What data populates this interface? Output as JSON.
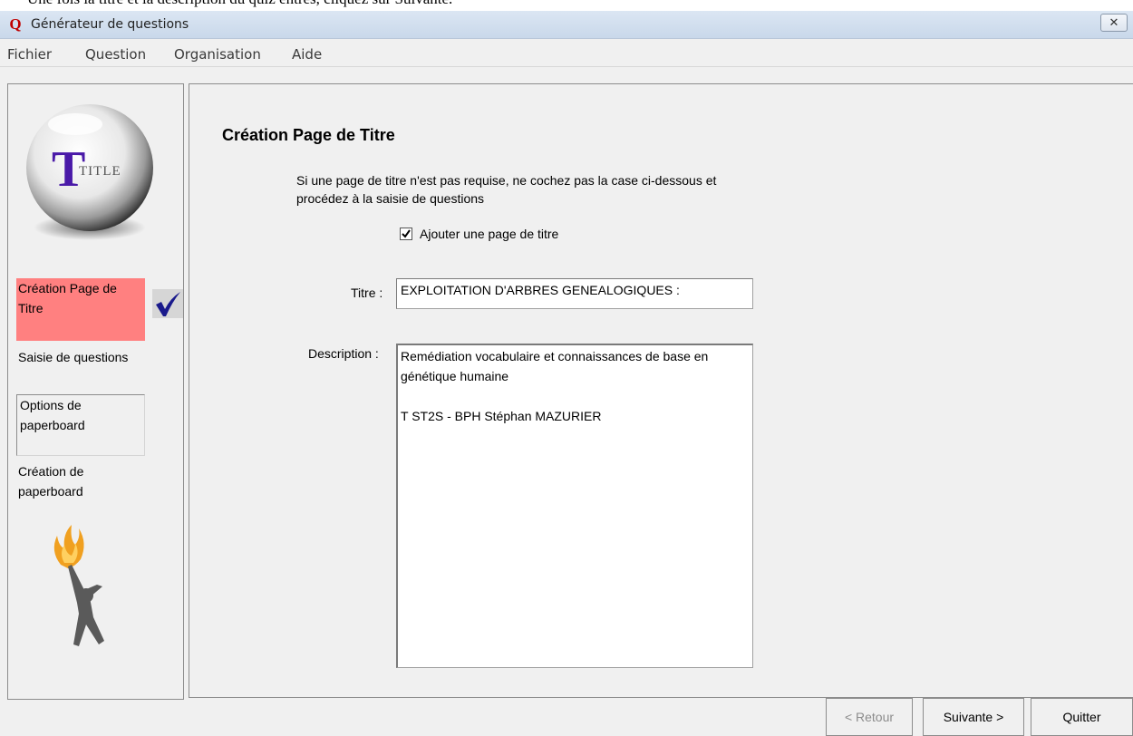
{
  "doc_fragment": "Une fois la titre et la description du quiz entrés, cliquez sur Suivante.",
  "window": {
    "title": "Générateur de questions",
    "app_icon": "Q",
    "close_glyph": "✕"
  },
  "menu": [
    "Fichier",
    "Question",
    "Organisation",
    "Aide"
  ],
  "sidebar": {
    "logo_text": "TITLE",
    "steps": [
      {
        "label": "Création Page de Titre",
        "state": "active",
        "completed": true
      },
      {
        "label": "Saisie de questions",
        "state": "normal"
      },
      {
        "label": "Options de paperboard",
        "state": "sunken"
      },
      {
        "label": "Création de paperboard",
        "state": "normal"
      }
    ],
    "check_icon": "checkmark-icon",
    "mascot_icon": "torch-figure-icon"
  },
  "main": {
    "title": "Création Page de Titre",
    "instruction": "Si une page de titre n'est pas requise, ne cochez pas la case ci-dessous et procédez à la saisie de questions",
    "add_title_checkbox": {
      "label": "Ajouter une page de titre",
      "checked": true
    },
    "titre_label": "Titre :",
    "titre_value": "EXPLOITATION D'ARBRES GENEALOGIQUES :",
    "description_label": "Description :",
    "description_value": "Remédiation vocabulaire et connaissances de base en génétique humaine\n\nT ST2S - BPH Stéphan MAZURIER"
  },
  "buttons": {
    "back": "< Retour",
    "next": "Suivante >",
    "quit": "Quitter"
  },
  "colors": {
    "active_step": "#ff8080",
    "check": "#1a1a8c",
    "window_bg": "#f0f0f0"
  }
}
